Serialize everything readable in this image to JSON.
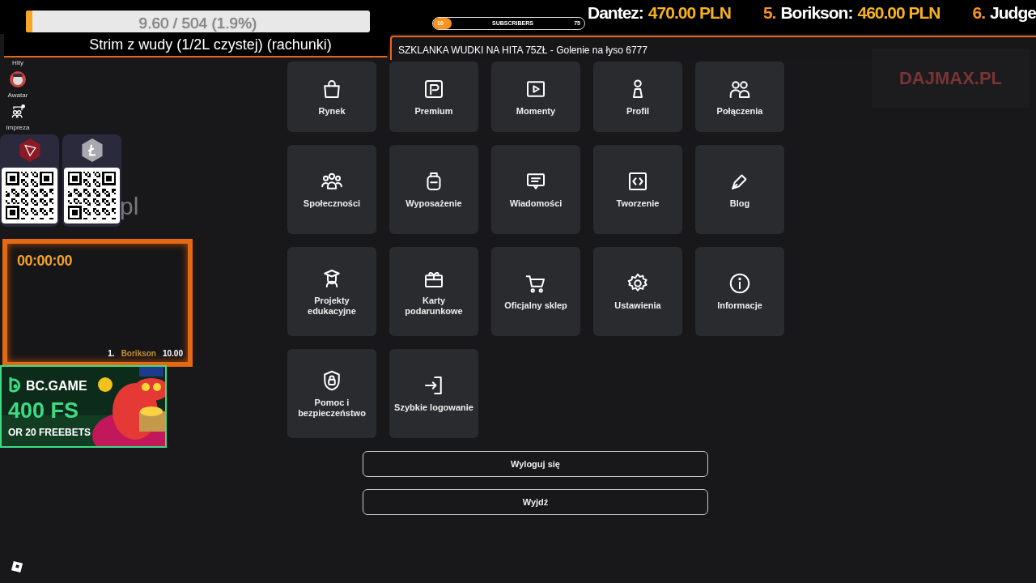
{
  "goal": {
    "reading": "9.60 / 504 (1.9%)",
    "level": 0.019,
    "title": "Strim z wudy (1/2L czystej) (rachunki)"
  },
  "subscribers": {
    "start": "10",
    "label": "SUBSCRIBERS",
    "end": "75"
  },
  "ticker": [
    {
      "name": "Dantez:",
      "amount": "470.00 PLN"
    },
    {
      "rank": "5.",
      "name": "Borikson:",
      "amount": "460.00 PLN"
    },
    {
      "rank": "6.",
      "name": "Judge"
    }
  ],
  "marquee": "SZKLANKA WUDKI NA HITA 75ZŁ - Golenie na łyso 6777",
  "sidebar": {
    "items": [
      {
        "kind": "text",
        "label": "Hity"
      },
      {
        "kind": "avatar",
        "label": "Awatar"
      },
      {
        "kind": "party",
        "label": "Impreza"
      }
    ]
  },
  "donation_qr": [
    {
      "kind": "tron"
    },
    {
      "kind": "litecoin"
    }
  ],
  "background_text": "pl",
  "timer": {
    "time": "00:00:00",
    "rank": "1.",
    "name": "Borikson",
    "amount": "10.00"
  },
  "ad": {
    "brand": "BC.GAME",
    "headline": "400 FS",
    "subline": "OR 20 FREEBETS"
  },
  "logo_text": "DAJMAX.PL",
  "menu": [
    {
      "kind": "bag",
      "label": "Rynek"
    },
    {
      "kind": "premium",
      "label": "Premium"
    },
    {
      "kind": "play",
      "label": "Momenty"
    },
    {
      "kind": "profile",
      "label": "Profil"
    },
    {
      "kind": "people",
      "label": "Połączenia"
    },
    {
      "kind": "community",
      "label": "Społeczności"
    },
    {
      "kind": "backpack",
      "label": "Wyposażenie"
    },
    {
      "kind": "message",
      "label": "Wiadomości"
    },
    {
      "kind": "code",
      "label": "Tworzenie"
    },
    {
      "kind": "pen",
      "label": "Blog"
    },
    {
      "kind": "grad",
      "label": "Projekty edukacyjne"
    },
    {
      "kind": "gift",
      "label": "Karty podarunkowe"
    },
    {
      "kind": "cart",
      "label": "Oficjalny sklep"
    },
    {
      "kind": "gear",
      "label": "Ustawienia"
    },
    {
      "kind": "info",
      "label": "Informacje"
    },
    {
      "kind": "shield",
      "label": "Pomoc i bezpieczeństwo"
    },
    {
      "kind": "login",
      "label": "Szybkie logowanie"
    }
  ],
  "buttons": [
    {
      "label": "Wyloguj się"
    },
    {
      "label": "Wyjdź"
    }
  ]
}
